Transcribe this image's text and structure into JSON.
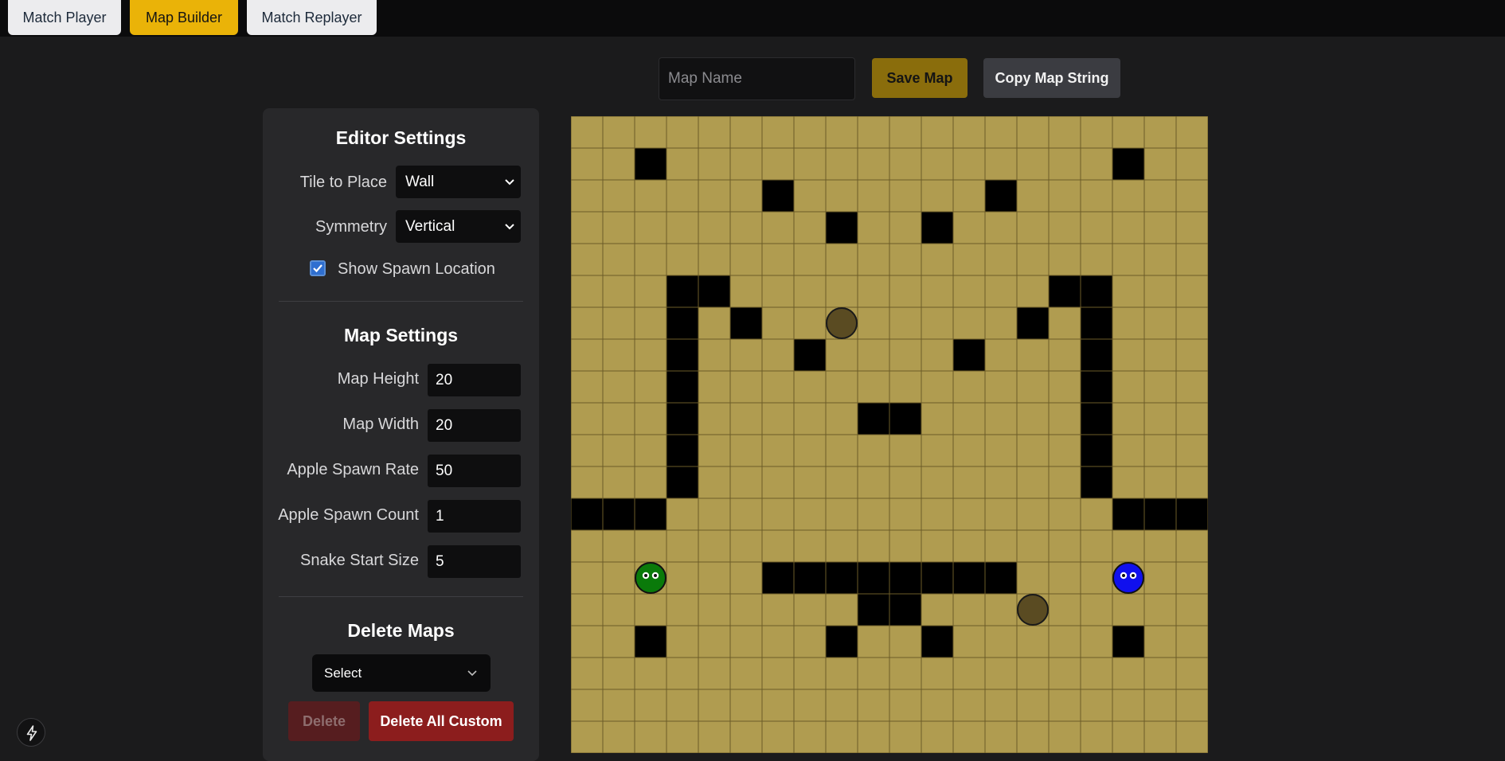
{
  "tabs": [
    {
      "label": "Match Player",
      "active": false
    },
    {
      "label": "Map Builder",
      "active": true
    },
    {
      "label": "Match Replayer",
      "active": false
    }
  ],
  "toolbar": {
    "map_name_placeholder": "Map Name",
    "map_name_value": "",
    "save_label": "Save Map",
    "copy_label": "Copy Map String"
  },
  "editor": {
    "title": "Editor Settings",
    "tile_label": "Tile to Place",
    "tile_value": "Wall",
    "symmetry_label": "Symmetry",
    "symmetry_value": "Vertical",
    "spawn_label": "Show Spawn Location",
    "spawn_checked": true
  },
  "map": {
    "title": "Map Settings",
    "height_label": "Map Height",
    "height_value": "20",
    "width_label": "Map Width",
    "width_value": "20",
    "apple_rate_label": "Apple Spawn Rate",
    "apple_rate_value": "50",
    "apple_count_label": "Apple Spawn Count",
    "apple_count_value": "1",
    "snake_size_label": "Snake Start Size",
    "snake_size_value": "5"
  },
  "delete": {
    "title": "Delete Maps",
    "select_value": "Select",
    "delete_label": "Delete",
    "delete_all_label": "Delete All Custom"
  },
  "icons": {
    "corner": "lightning-bolt-icon"
  },
  "colors": {
    "tile": "#b09c50",
    "grid_line": "#6b5b28",
    "wall": "#000000",
    "apple": "#5a4b22",
    "snake_a": "#0a7a0a",
    "snake_b": "#1010ee",
    "accent": "#eab308"
  },
  "board": {
    "cols": 20,
    "rows": 20,
    "walls": [
      [
        1,
        2
      ],
      [
        1,
        17
      ],
      [
        2,
        6
      ],
      [
        2,
        13
      ],
      [
        3,
        8
      ],
      [
        3,
        11
      ],
      [
        5,
        3
      ],
      [
        5,
        4
      ],
      [
        5,
        15
      ],
      [
        5,
        16
      ],
      [
        6,
        3
      ],
      [
        6,
        5
      ],
      [
        6,
        14
      ],
      [
        6,
        16
      ],
      [
        7,
        3
      ],
      [
        7,
        7
      ],
      [
        7,
        12
      ],
      [
        7,
        16
      ],
      [
        8,
        3
      ],
      [
        8,
        16
      ],
      [
        9,
        3
      ],
      [
        9,
        9
      ],
      [
        9,
        10
      ],
      [
        9,
        16
      ],
      [
        10,
        3
      ],
      [
        10,
        16
      ],
      [
        11,
        3
      ],
      [
        11,
        16
      ],
      [
        12,
        0
      ],
      [
        12,
        1
      ],
      [
        12,
        2
      ],
      [
        12,
        17
      ],
      [
        12,
        18
      ],
      [
        12,
        19
      ],
      [
        14,
        6
      ],
      [
        14,
        7
      ],
      [
        14,
        8
      ],
      [
        14,
        9
      ],
      [
        14,
        10
      ],
      [
        14,
        11
      ],
      [
        14,
        12
      ],
      [
        14,
        13
      ],
      [
        15,
        9
      ],
      [
        15,
        10
      ],
      [
        16,
        2
      ],
      [
        16,
        8
      ],
      [
        16,
        11
      ],
      [
        16,
        17
      ]
    ],
    "apples": [
      [
        6,
        8
      ],
      [
        15,
        14
      ]
    ],
    "snakes": [
      {
        "color": "#0a7a0a",
        "cell": [
          14,
          2
        ]
      },
      {
        "color": "#1010ee",
        "cell": [
          14,
          17
        ]
      }
    ]
  }
}
